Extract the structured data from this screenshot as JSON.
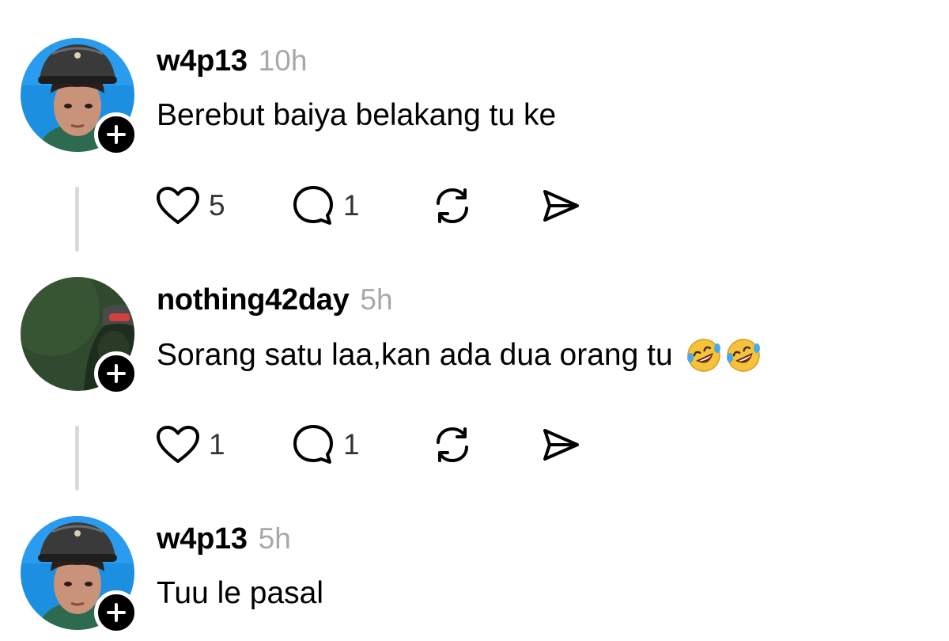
{
  "colors": {
    "text": "#000000",
    "secondary_text": "#a8a8a8",
    "count_text": "#333333",
    "thread_line": "#d9d9d9",
    "badge": "#000000"
  },
  "icons": {
    "like": "heart-outline",
    "reply": "speech-bubble-outline",
    "repost": "repost-arrows",
    "share": "paper-plane",
    "follow": "plus"
  },
  "posts": [
    {
      "username": "w4p13",
      "timestamp": "10h",
      "text": "Berebut baiya belakang tu ke",
      "like_count": "5",
      "reply_count": "1"
    },
    {
      "username": "nothing42day",
      "timestamp": "5h",
      "text": "Sorang satu laa,kan ada dua orang tu",
      "emoji": "rolling-on-floor-laughing x2",
      "like_count": "1",
      "reply_count": "1"
    },
    {
      "username": "w4p13",
      "timestamp": "5h",
      "text": "Tuu le pasal"
    }
  ]
}
